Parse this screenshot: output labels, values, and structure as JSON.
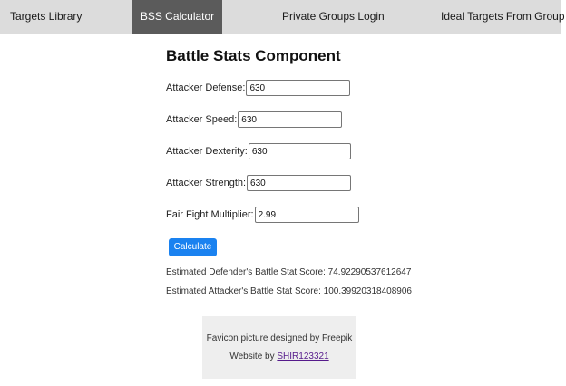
{
  "nav": {
    "items": [
      {
        "label": "Targets Library",
        "active": false
      },
      {
        "label": "BSS Calculator",
        "active": true
      },
      {
        "label": "Private Groups Login",
        "active": false
      },
      {
        "label": "Ideal Targets From Group",
        "active": false
      }
    ]
  },
  "main": {
    "title": "Battle Stats Component",
    "fields": {
      "defense": {
        "label": "Attacker Defense:",
        "value": "630"
      },
      "speed": {
        "label": "Attacker Speed:",
        "value": "630"
      },
      "dexterity": {
        "label": "Attacker Dexterity:",
        "value": "630"
      },
      "strength": {
        "label": "Attacker Strength:",
        "value": "630"
      },
      "ff": {
        "label": "Fair Fight Multiplier:",
        "value": "2.99"
      }
    },
    "calculate_label": "Calculate",
    "results": {
      "defender": "Estimated Defender's Battle Stat Score: 74.92290537612647",
      "attacker": "Estimated Attacker's Battle Stat Score: 100.39920318408906"
    }
  },
  "footer": {
    "credit": "Favicon picture designed by Freepik",
    "website_prefix": "Website by ",
    "website_link": "SHIR123321"
  },
  "colors": {
    "nav_bg": "#dcdcdc",
    "nav_active": "#5b5b5b",
    "button": "#1a82f0",
    "footer_bg": "#eeeeee"
  }
}
